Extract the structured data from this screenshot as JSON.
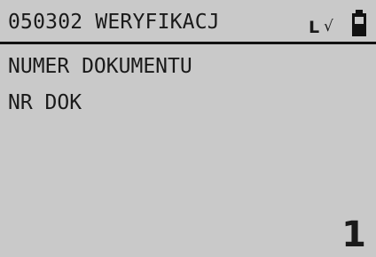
{
  "header": {
    "title": "050302 WERYFIKACJ",
    "status_letter": "L",
    "status_check": "√",
    "battery_icon": "battery-icon"
  },
  "content": {
    "line1": "NUMER DOKUMENTU",
    "line2": "NR DOK"
  },
  "footer": {
    "page_number": "1"
  },
  "colors": {
    "screen_background": "#c9c9c9",
    "text": "#1a1a1a",
    "divider": "#111111"
  }
}
